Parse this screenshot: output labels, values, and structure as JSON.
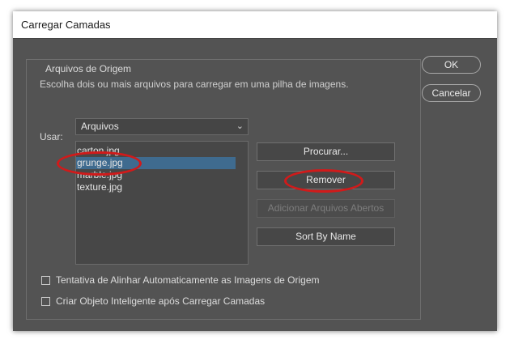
{
  "dialog": {
    "title": "Carregar Camadas"
  },
  "source_group": {
    "title": "Arquivos de Origem",
    "description": "Escolha dois ou mais arquivos para carregar em uma pilha de imagens."
  },
  "use": {
    "label": "Usar:",
    "selected": "Arquivos"
  },
  "files": [
    {
      "name": "carton.jpg"
    },
    {
      "name": "grunge.jpg",
      "selected": true
    },
    {
      "name": "marble.jpg"
    },
    {
      "name": "texture.jpg"
    }
  ],
  "buttons": {
    "browse": "Procurar...",
    "remove": "Remover",
    "add_open": "Adicionar Arquivos Abertos",
    "sort": "Sort By Name",
    "ok": "OK",
    "cancel": "Cancelar"
  },
  "options": {
    "align": {
      "label": "Tentativa de Alinhar Automaticamente as Imagens de Origem",
      "checked": false
    },
    "smart_object": {
      "label": "Criar Objeto Inteligente após Carregar Camadas",
      "checked": false
    }
  },
  "colors": {
    "panel": "#535353",
    "selection": "#3f6b8f",
    "annotation": "#d11a1a"
  }
}
